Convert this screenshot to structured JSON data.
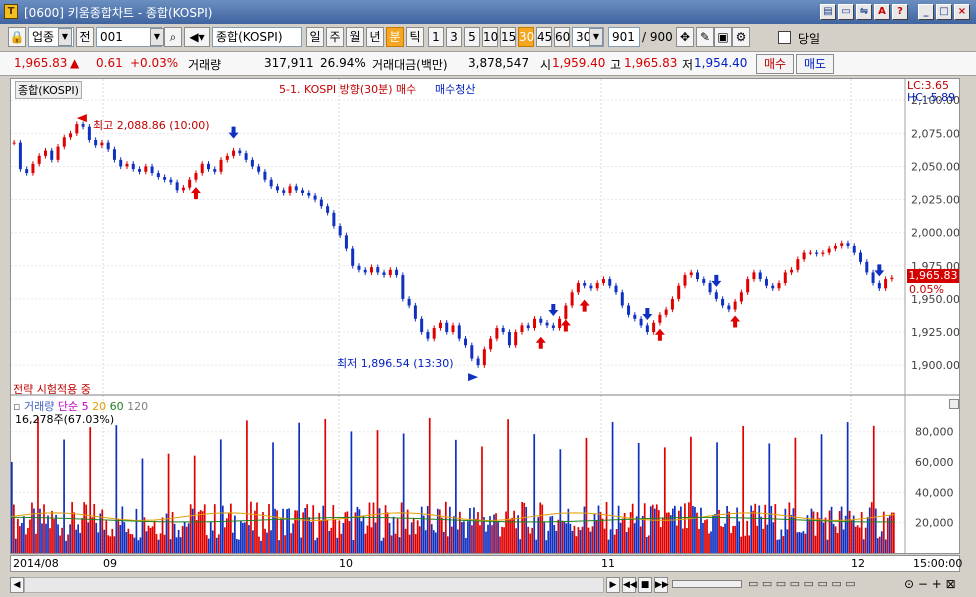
{
  "window": {
    "icon_label": "T",
    "title": "[0600] 키움종합차트 - 종합(KOSPI)"
  },
  "toolbar": {
    "category": "업종",
    "all_label": "전",
    "code": "001",
    "name": "종합(KOSPI)",
    "periods": [
      "일",
      "주",
      "월",
      "년",
      "분",
      "틱"
    ],
    "active_period": "분",
    "minutes": [
      "1",
      "3",
      "5",
      "10",
      "15",
      "30",
      "45",
      "60"
    ],
    "active_minute": "30",
    "interval_value": "30",
    "count_value": "901",
    "count_total": "/ 900",
    "today_label": "당일"
  },
  "quote": {
    "price": "1,965.83",
    "arrow": "▲",
    "change": "0.61",
    "change_pct": "+0.03%",
    "volume_label": "거래량",
    "volume": "317,911",
    "volume_pct": "26.94%",
    "amount_label": "거래대금(백만)",
    "amount": "3,878,547",
    "open_label": "시",
    "open": "1,959.40",
    "high_label": "고",
    "high": "1,965.83",
    "low_label": "저",
    "low": "1,954.40",
    "buy_label": "매수",
    "sell_label": "매도"
  },
  "price_panel": {
    "symbol": "종합(KOSPI)",
    "strategy_title": "5-1. KOSPI 방향(30분) 매수",
    "exit_label": "매수청산",
    "lc_label": "LC:3.65",
    "hc_label": "HC:-5.89",
    "current_price": "1,965.83",
    "current_pct": "0.05%",
    "max_label": "최고 2,088.86 (10:00)",
    "min_label": "최저 1,896.54 (13:30)",
    "test_label": "전략 시험적용 중"
  },
  "volume_panel": {
    "title": "거래량",
    "ma_label": "단순",
    "ma": [
      "5",
      "20",
      "60",
      "120"
    ],
    "ma_colors": [
      "#c000c0",
      "#e0a000",
      "#208020",
      "#808080"
    ],
    "current": "16,278주(67.03%)"
  },
  "axis": {
    "x_labels": [
      "2014/08",
      "09",
      "10",
      "11",
      "12"
    ],
    "time_label": "15:00:00"
  },
  "colors": {
    "up": "#e00000",
    "down": "#1030c0",
    "accent": "#f5a623"
  },
  "chart_data": [
    {
      "type": "line",
      "title": "",
      "y_ticks": [
        "2,100.00",
        "2,075.00",
        "2,050.00",
        "2,025.00",
        "2,000.00",
        "1,975.00",
        "1,950.00",
        "1,925.00",
        "1,900.00"
      ],
      "ylim": [
        1885,
        2110
      ],
      "x": [
        "2014/08",
        "",
        "",
        "",
        "",
        "",
        "",
        "",
        "",
        "",
        "",
        "",
        "09",
        "",
        "",
        "",
        "",
        "",
        "",
        "",
        "",
        "",
        "",
        "",
        "",
        "",
        "",
        "",
        "",
        "",
        "",
        "",
        "",
        "",
        "",
        "",
        "",
        "",
        "",
        "",
        "",
        "",
        "10",
        "",
        "",
        "",
        "",
        "",
        "",
        "",
        "",
        "",
        "",
        "",
        "",
        "",
        "",
        "",
        "",
        "",
        "",
        "",
        "",
        "",
        "",
        "",
        "",
        "",
        "",
        "",
        "",
        "",
        "",
        "",
        "",
        "",
        "",
        "",
        "",
        "",
        "",
        "",
        "11",
        "",
        "",
        "",
        "",
        "",
        "",
        "",
        "",
        "",
        "",
        "",
        "",
        "",
        "",
        "",
        "",
        "",
        "",
        "",
        "",
        "",
        "",
        "",
        "",
        "",
        "",
        "",
        "",
        "",
        "",
        "",
        "",
        "",
        "",
        "",
        "",
        "",
        "12",
        "",
        "",
        "",
        "",
        ""
      ],
      "series": [
        {
          "values": [
            2068,
            2048,
            2045,
            2052,
            2058,
            2062,
            2055,
            2065,
            2072,
            2075,
            2082,
            2080,
            2070,
            2066,
            2068,
            2063,
            2055,
            2050,
            2052,
            2048,
            2046,
            2050,
            2045,
            2042,
            2040,
            2038,
            2032,
            2034,
            2040,
            2045,
            2052,
            2048,
            2046,
            2055,
            2058,
            2062,
            2060,
            2055,
            2050,
            2046,
            2040,
            2035,
            2032,
            2030,
            2035,
            2032,
            2030,
            2028,
            2025,
            2020,
            2015,
            2005,
            1998,
            1988,
            1975,
            1972,
            1970,
            1974,
            1970,
            1968,
            1972,
            1968,
            1950,
            1945,
            1935,
            1925,
            1920,
            1928,
            1932,
            1925,
            1930,
            1920,
            1915,
            1905,
            1900,
            1912,
            1920,
            1928,
            1925,
            1915,
            1925,
            1930,
            1928,
            1935,
            1932,
            1930,
            1928,
            1935,
            1945,
            1955,
            1962,
            1960,
            1958,
            1962,
            1965,
            1960,
            1955,
            1945,
            1938,
            1935,
            1930,
            1925,
            1932,
            1938,
            1942,
            1950,
            1960,
            1968,
            1970,
            1965,
            1962,
            1955,
            1950,
            1945,
            1942,
            1948,
            1955,
            1965,
            1970,
            1965,
            1960,
            1958,
            1962,
            1970,
            1972,
            1980,
            1985,
            1985,
            1984,
            1985,
            1988,
            1990,
            1992,
            1990,
            1985,
            1978,
            1970,
            1962,
            1958,
            1965,
            1966
          ]
        }
      ]
    },
    {
      "type": "bar",
      "title": "거래량",
      "y_ticks": [
        "80,000",
        "60,000",
        "40,000",
        "20,000"
      ],
      "ylim": [
        0,
        95000
      ],
      "series": [
        {
          "name": "거래량",
          "values": []
        }
      ]
    }
  ]
}
